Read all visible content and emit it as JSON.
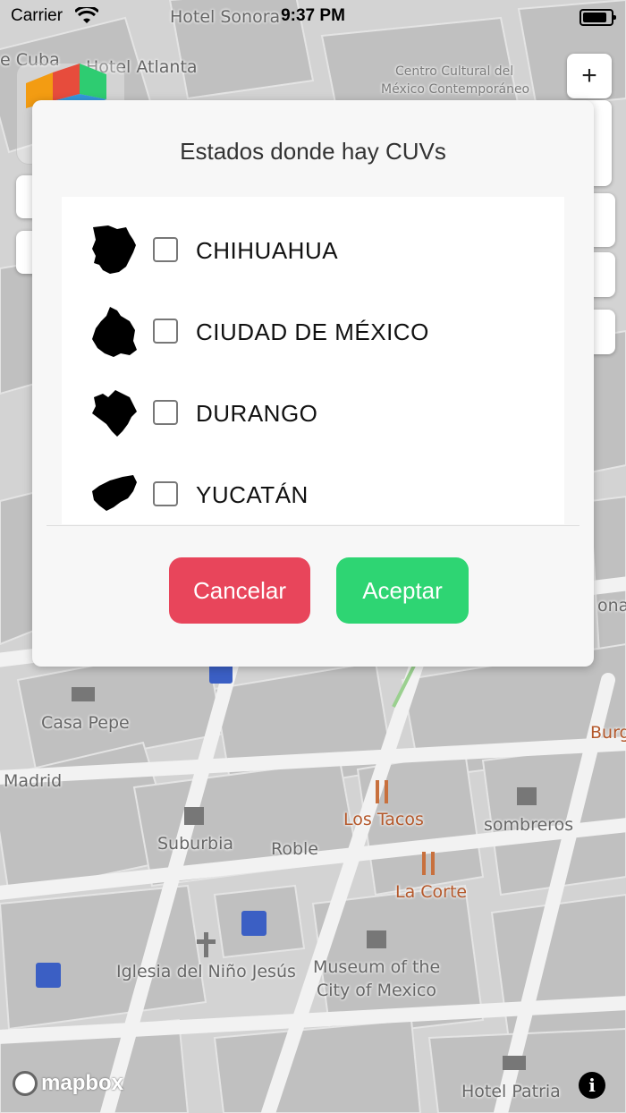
{
  "status_bar": {
    "carrier": "Carrier",
    "time": "9:37 PM"
  },
  "map": {
    "labels": [
      {
        "text": "Hotel Sonora"
      },
      {
        "text": "Hotel Atlanta"
      },
      {
        "text": "e Cuba"
      },
      {
        "text": "Centro Cultural del"
      },
      {
        "text": "México Contemporáneo"
      },
      {
        "text": "Casa Pepe"
      },
      {
        "text": "Madrid"
      },
      {
        "text": "Los Tacos"
      },
      {
        "text": "sombreros"
      },
      {
        "text": "Suburbia"
      },
      {
        "text": "Roble"
      },
      {
        "text": "La Corte"
      },
      {
        "text": "Museum of the"
      },
      {
        "text": "City of Mexico"
      },
      {
        "text": "Iglesia del Niño Jesús"
      },
      {
        "text": "Hotel Patria"
      },
      {
        "text": "Burg"
      },
      {
        "text": "onal"
      }
    ],
    "attribution": "mapbox",
    "zoom_in_label": "+"
  },
  "modal": {
    "title": "Estados donde hay CUVs",
    "states": [
      {
        "label": "CHIHUAHUA",
        "checked": false,
        "icon": "chihuahua-shape-icon"
      },
      {
        "label": "CIUDAD DE MÉXICO",
        "checked": false,
        "icon": "cdmx-shape-icon"
      },
      {
        "label": "DURANGO",
        "checked": false,
        "icon": "durango-shape-icon"
      },
      {
        "label": "YUCATÁN",
        "checked": false,
        "icon": "yucatan-shape-icon"
      }
    ],
    "cancel_label": "Cancelar",
    "accept_label": "Aceptar",
    "colors": {
      "cancel": "#e8455b",
      "accept": "#2ed573"
    }
  }
}
